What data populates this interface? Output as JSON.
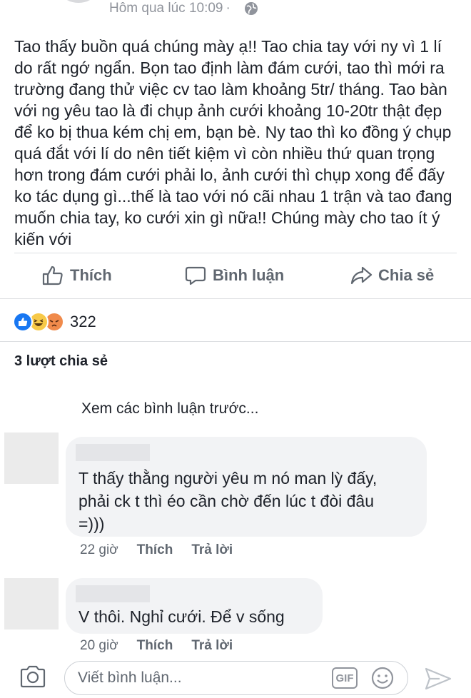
{
  "post": {
    "timestamp": "Hôm qua lúc 10:09",
    "separator": "·",
    "text": "Tao thấy buồn quá chúng mày ạ!! Tao chia tay với ny vì 1 lí do rất ngớ ngẩn. Bọn tao định làm đám cưới, tao thì mới ra trường đang thử việc cv tao làm khoảng 5tr/ tháng. Tao bàn với ng yêu tao là đi chụp ảnh cưới khoảng 10-20tr thật đẹp để ko bị thua kém chị em, bạn bè. Ny tao thì ko đồng ý chụp quá đắt với lí do nên tiết kiệm vì còn nhiều thứ quan trọng hơn trong đám cưới phải lo, ảnh cưới thì chụp xong để đấy ko tác dụng gì...thế là tao với nó cãi nhau 1 trận và tao đang muốn chia tay, ko cưới xin gì nữa!! Chúng mày cho tao ít ý kiến với"
  },
  "actions": {
    "like": "Thích",
    "comment": "Bình luận",
    "share": "Chia sẻ"
  },
  "reactions": {
    "count": "322",
    "icons": [
      "like-reaction",
      "haha-reaction",
      "angry-reaction"
    ]
  },
  "shares": "3 lượt chia sẻ",
  "previous_comments": "Xem các bình luận trước...",
  "comments": [
    {
      "text_lines": [
        "T thấy thằng người yêu m nó man lỳ đấy,",
        "phải ck t thì éo cần chờ đến lúc t đòi đâu",
        "=)))"
      ],
      "time": "22 giờ",
      "like": "Thích",
      "reply": "Trả lời"
    },
    {
      "text_lines": [
        "V thôi. Nghỉ cưới. Để v sống"
      ],
      "time": "20 giờ",
      "like": "Thích",
      "reply": "Trả lời"
    }
  ],
  "composer": {
    "placeholder": "Viết bình luận...",
    "gif_label": "GIF"
  },
  "colors": {
    "accent": "#1877f2",
    "text": "#1d2129",
    "muted": "#606770",
    "bubble": "#f2f3f5"
  }
}
